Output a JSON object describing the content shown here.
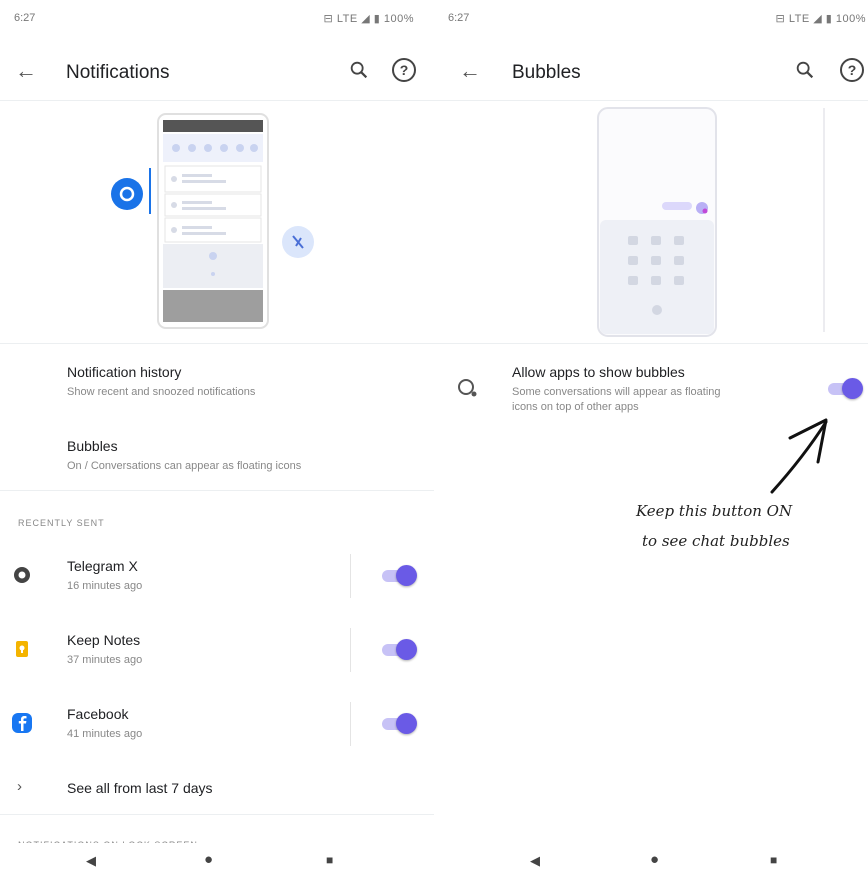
{
  "left_screen": {
    "status": {
      "time": "6:27",
      "icons": "⊟ LTE ◢ ▮ 100%"
    },
    "appbar": {
      "title": "Notifications",
      "back_icon": "arrow-back-icon",
      "search_icon": "search-icon",
      "help_icon": "help-icon",
      "help_glyph": "?"
    },
    "settings": [
      {
        "title": "Notification history",
        "subtitle": "Show recent and snoozed notifications"
      },
      {
        "title": "Bubbles",
        "subtitle": "On / Conversations can appear as floating icons"
      }
    ],
    "recently_sent": {
      "header": "RECENTLY SENT",
      "apps": [
        {
          "name": "Telegram X",
          "time": "16 minutes ago",
          "icon": "telegram-x-icon",
          "enabled": true
        },
        {
          "name": "Keep Notes",
          "time": "37 minutes ago",
          "icon": "keep-notes-icon",
          "enabled": true
        },
        {
          "name": "Facebook",
          "time": "41 minutes ago",
          "icon": "facebook-icon",
          "enabled": true
        }
      ],
      "see_all": "See all from last 7 days",
      "see_all_icon": "chevron-right-icon"
    },
    "lockscreen_header": "NOTIFICATIONS ON LOCK SCREEN"
  },
  "right_screen": {
    "status": {
      "time": "6:27",
      "icons": "⊟ LTE ◢ ▮ 100%"
    },
    "appbar": {
      "title": "Bubbles",
      "back_icon": "arrow-back-icon",
      "search_icon": "search-icon",
      "help_icon": "help-icon",
      "help_glyph": "?"
    },
    "setting": {
      "title": "Allow apps to show bubbles",
      "subtitle_line1": "Some conversations will appear as floating",
      "subtitle_line2": "icons on top of other apps",
      "icon": "bubble-icon",
      "enabled": true
    },
    "annotation": {
      "line1": "Keep this button ON",
      "line2": "to see chat bubbles"
    }
  },
  "navbar": {
    "back": "◀",
    "home": "●",
    "recents": "■"
  },
  "colors": {
    "accent": "#6a5ae6",
    "accent_track": "#c7c2f6",
    "facebook": "#1877f2",
    "keep": "#f4b400",
    "illus_blue": "#1a73e8"
  }
}
